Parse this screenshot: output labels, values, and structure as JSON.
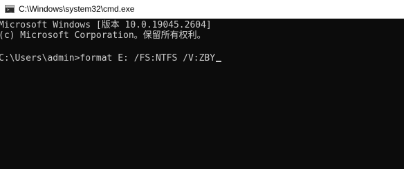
{
  "window": {
    "title": "C:\\Windows\\system32\\cmd.exe",
    "icon": "cmd-icon"
  },
  "console": {
    "lines": [
      "Microsoft Windows [版本 10.0.19045.2604]",
      "(c) Microsoft Corporation。保留所有权利。"
    ],
    "prompt": "C:\\Users\\admin>",
    "command": "format E: /FS:NTFS /V:ZBY"
  },
  "colors": {
    "console_background": "#0c0c0c",
    "console_text": "#cccccc",
    "titlebar_background": "#ffffff"
  }
}
